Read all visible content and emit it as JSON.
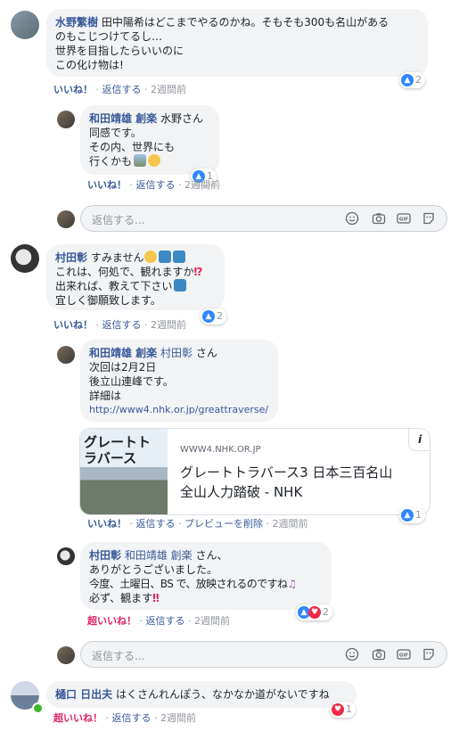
{
  "comments": [
    {
      "author": "水野繁樹",
      "lines": [
        "田中陽希はどこまでやるのかね。そもそも300も名山がある",
        "のもこじつけてるし…",
        "世界を目指したらいいのに",
        "この化け物は!"
      ],
      "like_action": "いいね！",
      "reply_action": "返信する",
      "time": "2週間前",
      "reactions": "2"
    },
    {
      "author": "和田靖雄 創楽",
      "mention": "水野さん",
      "lines": [
        "同感です。",
        "その内、世界にも",
        "行くかも"
      ],
      "like_action": "いいね！",
      "reply_action": "返信する",
      "time": "2週間前",
      "reactions": "1"
    },
    {
      "author": "村田彰",
      "first": "すみません",
      "lines": [
        "これは、何処で、観れますか",
        "出来れば、教えて下さい",
        "宜しく御願致します。"
      ],
      "like_action": "いいね！",
      "reply_action": "返信する",
      "time": "2週間前",
      "reactions": "2"
    },
    {
      "author": "和田靖雄 創楽",
      "mention": "村田彰",
      "mention_suffix": "さん",
      "lines": [
        "次回は2月2日",
        "後立山連峰です。",
        "詳細は",
        "http://www4.nhk.or.jp/greattraverse/"
      ],
      "card": {
        "thumb_text": "グレートトラバース",
        "domain": "WWW4.NHK.OR.JP",
        "title_1": "グレートトラバース3 日本三百名山",
        "title_2": "全山人力踏破 - NHK",
        "info": "i"
      },
      "like_action": "いいね！",
      "reply_action": "返信する",
      "preview_action": "プレビューを削除",
      "time": "2週間前",
      "reactions": "1"
    },
    {
      "author": "村田彰",
      "mention": "和田靖雄 創楽",
      "mention_suffix": "さん、",
      "lines": [
        "ありがとうございました。",
        "今度、土曜日、BS で、放映されるのですね",
        "必ず、観ます"
      ],
      "like_action": "超いいね！",
      "reply_action": "返信する",
      "time": "2週間前",
      "reactions": "2"
    },
    {
      "author": "樋口 日出夫",
      "text": "はくさんれんぽう、なかなか道がないですね",
      "like_action": "超いいね！",
      "reply_action": "返信する",
      "time": "2週間前",
      "reactions": "1"
    }
  ],
  "reply_box": {
    "placeholder": "返信する..."
  },
  "separator": "·",
  "colors": {
    "link": "#385898",
    "bubble": "#f2f3f5",
    "like": "#2d88ff",
    "love": "#f02849",
    "meta": "#90949c"
  },
  "icons": [
    "smiley-icon",
    "camera-icon",
    "gif-icon",
    "sticker-icon"
  ]
}
